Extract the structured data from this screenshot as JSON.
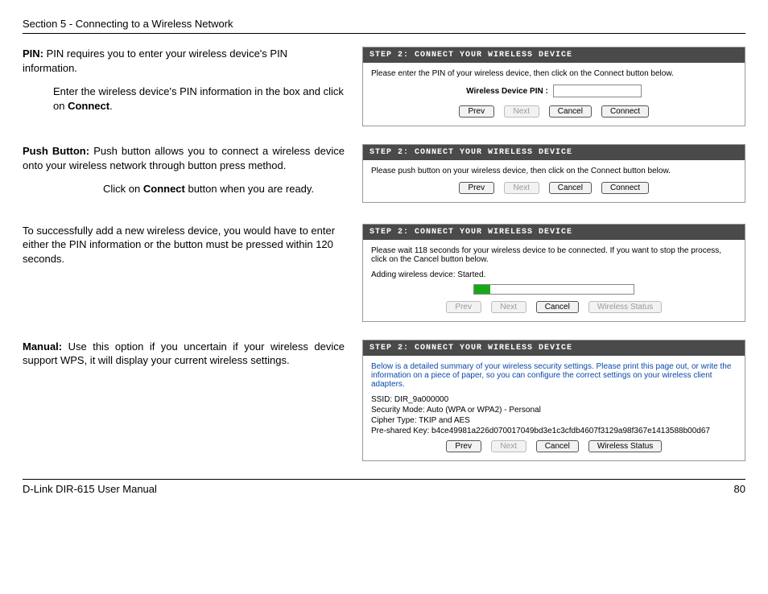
{
  "header": {
    "section_label": "Section 5 - Connecting to a Wireless Network"
  },
  "footer": {
    "manual_label": "D-Link DIR-615 User Manual",
    "page_number": "80"
  },
  "pin": {
    "term": "PIN:",
    "desc_a": "PIN requires you to enter your wireless device's PIN information.",
    "desc_b_pre": "Enter the wireless device's PIN information in the box and click on ",
    "desc_b_bold": "Connect",
    "desc_b_post": "."
  },
  "push": {
    "term": "Push Button:",
    "desc_a": "Push button allows you to connect a wireless device onto your wireless network through button press method.",
    "desc_b_pre": "Click on ",
    "desc_b_bold": "Connect",
    "desc_b_post": " button when you are ready."
  },
  "mid_para": "To successfully add a new wireless device, you would have to enter either the PIN information or the button must be pressed within 120 seconds.",
  "manual": {
    "term": "Manual:",
    "desc": "Use this option if you uncertain if your wireless device support WPS, it will display your current wireless settings."
  },
  "panels": {
    "header": "STEP 2: CONNECT YOUR WIRELESS DEVICE",
    "pin_instr": "Please enter the PIN of your wireless device, then click on the Connect button below.",
    "pin_field_label": "Wireless Device PIN :",
    "push_instr": "Please push button on your wireless device, then click on the Connect button below.",
    "progress_instr": "Please wait 118 seconds for your wireless device to be connected. If you want to stop the process, click on the Cancel button below.",
    "progress_status": "Adding wireless device: Started.",
    "summary_instr": "Below is a detailed summary of your wireless security settings. Please print this page out, or write the information on a piece of paper, so you can configure the correct settings on your wireless client adapters.",
    "ssid": "SSID: DIR_9a000000",
    "sec_mode": "Security Mode: Auto (WPA or WPA2) - Personal",
    "cipher": "Cipher Type: TKIP and AES",
    "psk": "Pre-shared Key: b4ce49981a226d070017049bd3e1c3cfdb4607f3129a98f367e1413588b00d67",
    "buttons": {
      "prev": "Prev",
      "next": "Next",
      "cancel": "Cancel",
      "connect": "Connect",
      "wireless_status": "Wireless Status"
    }
  }
}
